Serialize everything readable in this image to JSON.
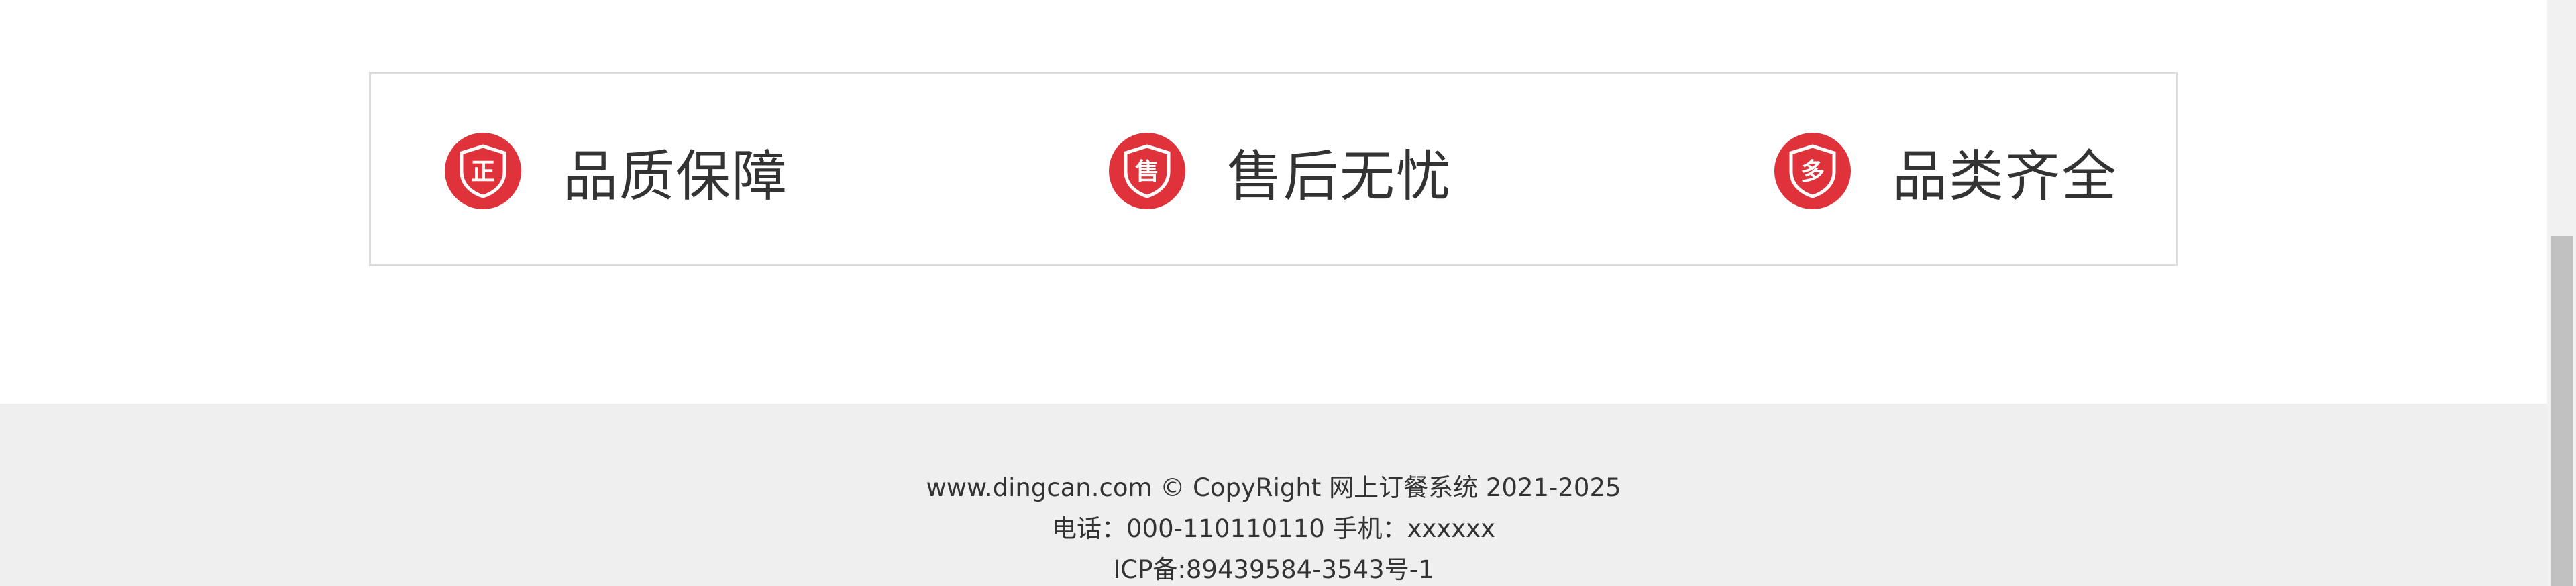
{
  "features": [
    {
      "icon": "shield-zheng-icon",
      "badge_char": "正",
      "label": "品质保障"
    },
    {
      "icon": "shield-shou-icon",
      "badge_char": "售",
      "label": "售后无忧"
    },
    {
      "icon": "shield-duo-icon",
      "badge_char": "多",
      "label": "品类齐全"
    }
  ],
  "colors": {
    "accent": "#e0323a",
    "footer_bg": "#efefef",
    "text": "#333333",
    "border": "#dcdcdc"
  },
  "footer": {
    "copyright": "www.dingcan.com © CopyRight 网上订餐系统 2021-2025",
    "contact": "电话：000-110110110 手机：xxxxxx",
    "icp": "ICP备:89439584-3543号-1"
  }
}
